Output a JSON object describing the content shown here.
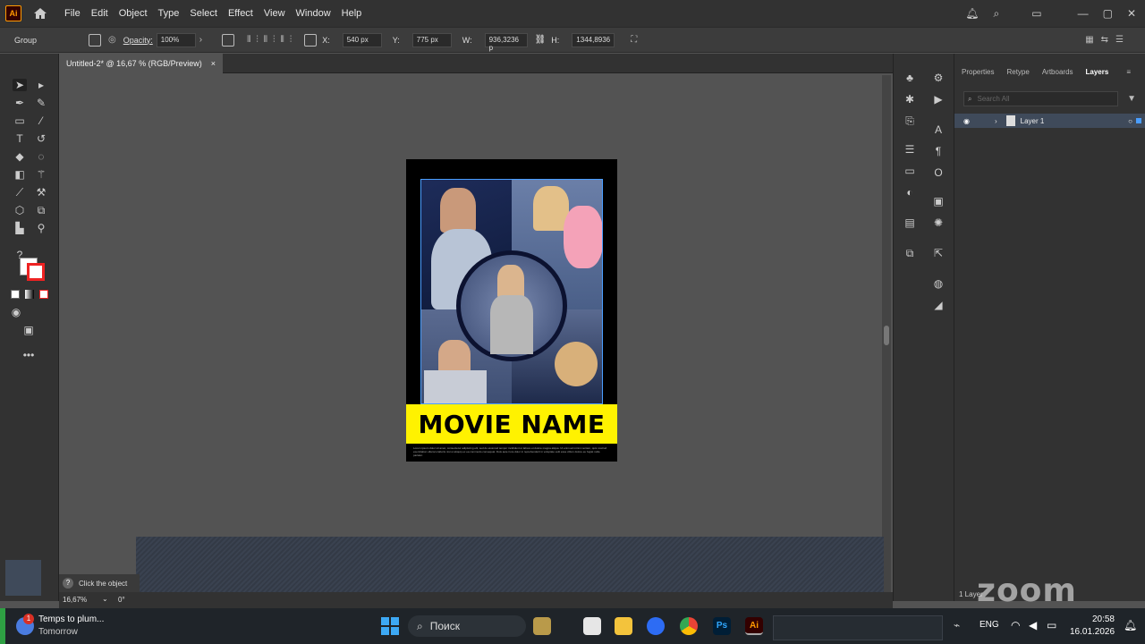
{
  "app": {
    "logo": "Ai",
    "menus": [
      "File",
      "Edit",
      "Object",
      "Type",
      "Select",
      "Effect",
      "View",
      "Window",
      "Help"
    ]
  },
  "control": {
    "selection_label": "Group",
    "opacity_label": "Opacity:",
    "opacity_value": "100%",
    "x_label": "X:",
    "x_value": "540 px",
    "y_label": "Y:",
    "y_value": "775 px",
    "w_label": "W:",
    "w_value": "936,3236 p",
    "h_label": "H:",
    "h_value": "1344,8936"
  },
  "document": {
    "tab_title": "Untitled-2* @ 16,67 % (RGB/Preview)",
    "close": "×"
  },
  "poster": {
    "title": "MOVIE NAME",
    "fine_print": "Lorem ipsum dolor sit amet, consectetur adipiscing elit, sed do eiusmod tempor incididunt ut labore et dolore magna aliqua. Ut enim ad minim veniam, quis nostrud exercitation ullamco laboris nisi ut aliquip ex ea commodo consequat. Duis aute irure dolor in reprehenderit in voluptate velit esse cillum dolore eu fugiat nulla pariatur."
  },
  "panel": {
    "tabs": [
      "Properties",
      "Retype",
      "Artboards",
      "Layers"
    ],
    "search_placeholder": "Search All",
    "layer_name": "Layer 1",
    "layer_count": "1 Layer"
  },
  "status": {
    "hint": "Click the object",
    "zoom": "16,67%",
    "rotation": "0°"
  },
  "taskbar": {
    "notif_title": "Temps to plum...",
    "notif_sub": "Tomorrow",
    "notif_badge": "1",
    "search": "Поиск",
    "lang": "ENG",
    "time": "20:58",
    "date": "16.01.2026"
  },
  "watermark": "zoom"
}
